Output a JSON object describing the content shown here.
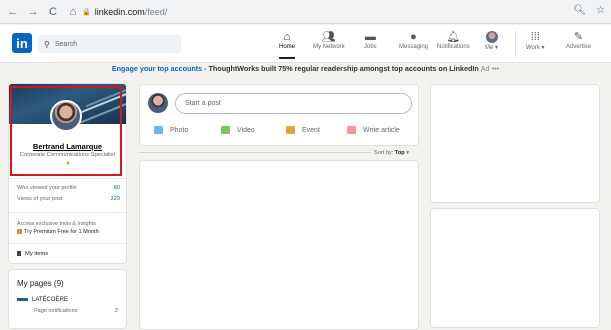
{
  "browser": {
    "url_host": "linkedin.com",
    "url_path": "/feed/"
  },
  "header": {
    "logo": "in",
    "search_placeholder": "Search",
    "nav": {
      "home": "Home",
      "network": "My Network",
      "jobs": "Jobs",
      "messaging": "Messaging",
      "notifications": "Notifications",
      "me": "Me ▾",
      "work": "Work ▾",
      "advertise": "Advertise"
    }
  },
  "banner": {
    "highlight": "Engage your top accounts",
    "rest": " - ThoughtWorks built 75% regular readership amongst top accounts on LinkedIn",
    "ad": "Ad",
    "more": "•••"
  },
  "profile": {
    "name": "Bertrand Lamarque",
    "title": "Corporate Communications Specialist",
    "viewed_label": "Who viewed your profile",
    "viewed_value": "80",
    "post_views_label": "Views of your post",
    "post_views_value": "229",
    "premium_text": "Access exclusive tools & insights",
    "premium_link": "Try Premium Free for 1 Month",
    "my_items": "My items"
  },
  "pages": {
    "title": "My pages (9)",
    "item_name": "LATÉCOÈRE",
    "notif_label": "Page notifications",
    "notif_value": "2"
  },
  "post": {
    "placeholder": "Start a post",
    "photo": "Photo",
    "video": "Video",
    "event": "Event",
    "article": "Write article",
    "sort_label": "Sort by:",
    "sort_value": "Top"
  },
  "colors": {
    "brand": "#0a66c2",
    "highlight_box": "#d4151c",
    "photo_icon": "#70b5f9",
    "video_icon": "#7fc15e",
    "event_icon": "#e7a33e",
    "article_icon": "#fc9295"
  }
}
